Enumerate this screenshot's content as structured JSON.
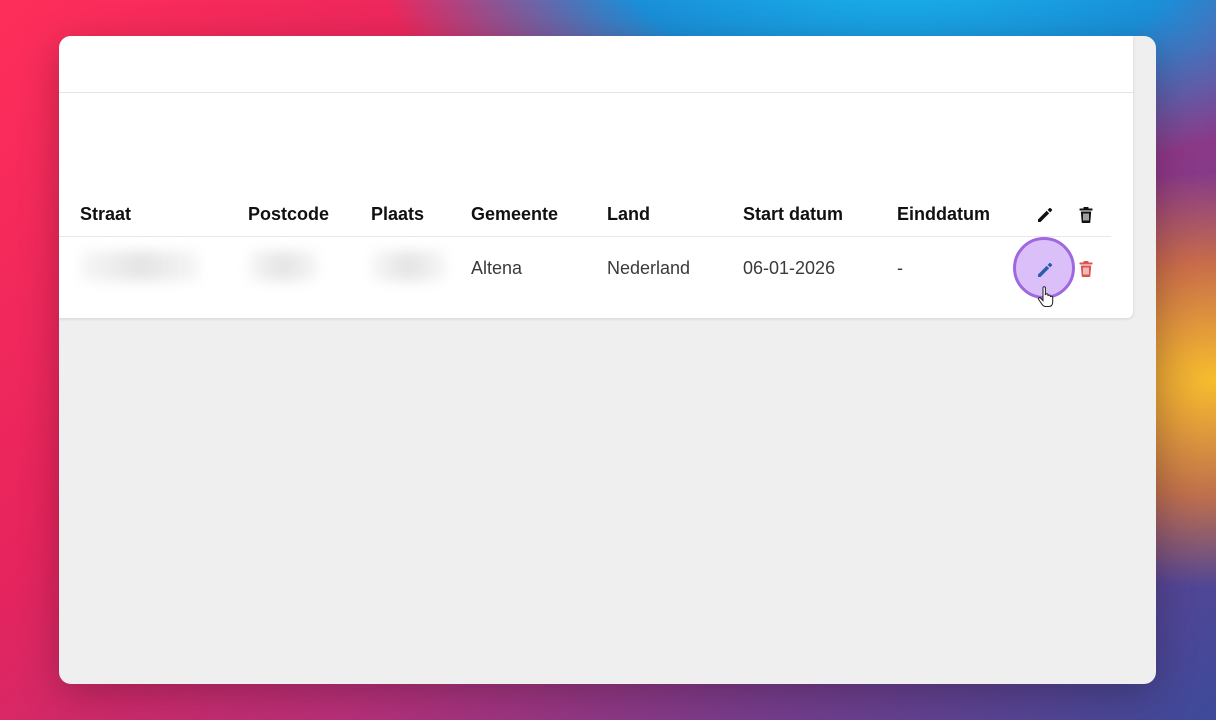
{
  "table": {
    "headers": {
      "straat": "Straat",
      "postcode": "Postcode",
      "plaats": "Plaats",
      "gemeente": "Gemeente",
      "land": "Land",
      "start_datum": "Start datum",
      "einddatum": "Einddatum"
    },
    "header_icons": [
      "pencil-icon",
      "trash-icon"
    ],
    "rows": [
      {
        "straat": "",
        "postcode": "",
        "plaats": "",
        "gemeente": "Altena",
        "land": "Nederland",
        "start_datum": "06-01-2026",
        "einddatum": "-",
        "actions": [
          "edit-icon",
          "delete-icon"
        ]
      }
    ]
  },
  "colors": {
    "edit_icon": "#2b5cad",
    "delete_icon": "#d9534f",
    "highlight_ring": "#a068e0",
    "header_text": "#111111"
  }
}
